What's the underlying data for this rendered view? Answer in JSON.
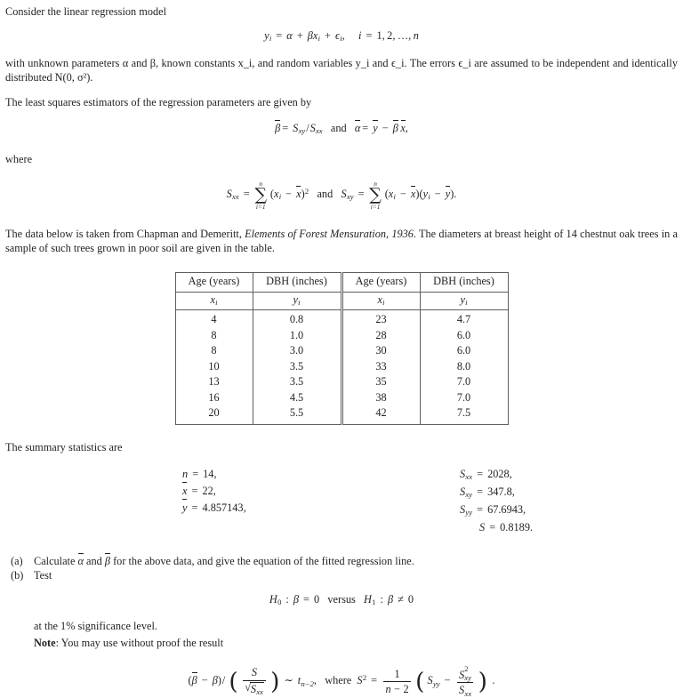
{
  "document": {
    "type": "statistics-exam-question",
    "intro_paragraph": "Consider the linear regression model",
    "model_equation": "y_i = α + βx_i + ϵ_i,   i = 1, 2, … , n",
    "parameters_paragraph": "with unknown parameters α and β, known constants x_i, and random variables y_i and ϵ_i. The errors ϵ_i are assumed to be independent and identically distributed N(0, σ²).",
    "estimators_paragraph": "The least squares estimators of the regression parameters are given by",
    "estimators_equation": "β̂ = S_xy / S_xx   and   α̂ = ȳ − β̂ x̄,",
    "where_label": "where",
    "sums_equation": "S_xx = ∑_{i=1}^{n} (x_i − x̄)²   and   S_xy = ∑_{i=1}^{n} (x_i − x̄)(y_i − ȳ).",
    "data_source_paragraph_part1": "The data below is taken from Chapman and Demeritt, ",
    "data_source_citation": "Elements of Forest Mensuration, 1936",
    "data_source_paragraph_part2": ". The diameters at breast height of 14 chestnut oak trees in a sample of such trees grown in poor soil are given in the table.",
    "summary_intro": "The summary statistics are"
  },
  "table": {
    "headers": [
      "Age (years)",
      "DBH (inches)",
      "Age (years)",
      "DBH (inches)"
    ],
    "symbol_row": [
      "x_i",
      "y_i",
      "x_i",
      "y_i"
    ],
    "left_x": [
      "4",
      "8",
      "8",
      "10",
      "13",
      "16",
      "20"
    ],
    "left_y": [
      "0.8",
      "1.0",
      "3.0",
      "3.5",
      "3.5",
      "4.5",
      "5.5"
    ],
    "right_x": [
      "23",
      "28",
      "30",
      "33",
      "35",
      "38",
      "42"
    ],
    "right_y": [
      "4.7",
      "6.0",
      "6.0",
      "8.0",
      "7.0",
      "7.0",
      "7.5"
    ]
  },
  "summary_statistics": {
    "left": [
      {
        "symbol": "n",
        "value": "14,"
      },
      {
        "symbol": "x̄",
        "value": "22,"
      },
      {
        "symbol": "ȳ",
        "value": "4.857143,"
      }
    ],
    "right": [
      {
        "symbol": "S_xx",
        "value": "2028,"
      },
      {
        "symbol": "S_xy",
        "value": "347.8,"
      },
      {
        "symbol": "S_yy",
        "value": "67.6943,"
      },
      {
        "symbol": "S",
        "value": "0.8189."
      }
    ]
  },
  "questions": {
    "a": {
      "label": "(a)",
      "text": "Calculate α̂ and β̂ for the above data, and give the equation of the fitted regression line."
    },
    "b": {
      "label": "(b)",
      "text": "Test",
      "hypotheses": "H₀ : β = 0   versus   H₁ : β ≠ 0",
      "significance_line": "at the 1% significance level.",
      "note_label": "Note",
      "note_text": ": You may use without proof the result",
      "result_formula": "(β̂ − β) / ( S / √S_xx ) ~ t_{n−2},  where S² = 1/(n−2) ( S_yy − S_xy² / S_xx )."
    }
  },
  "labels": {
    "versus": "versus",
    "and": "and",
    "where": "where",
    "significance_level": "1%"
  },
  "colors": {
    "text": "#231f20",
    "rule": "#5f5f61",
    "background": "#ffffff"
  }
}
